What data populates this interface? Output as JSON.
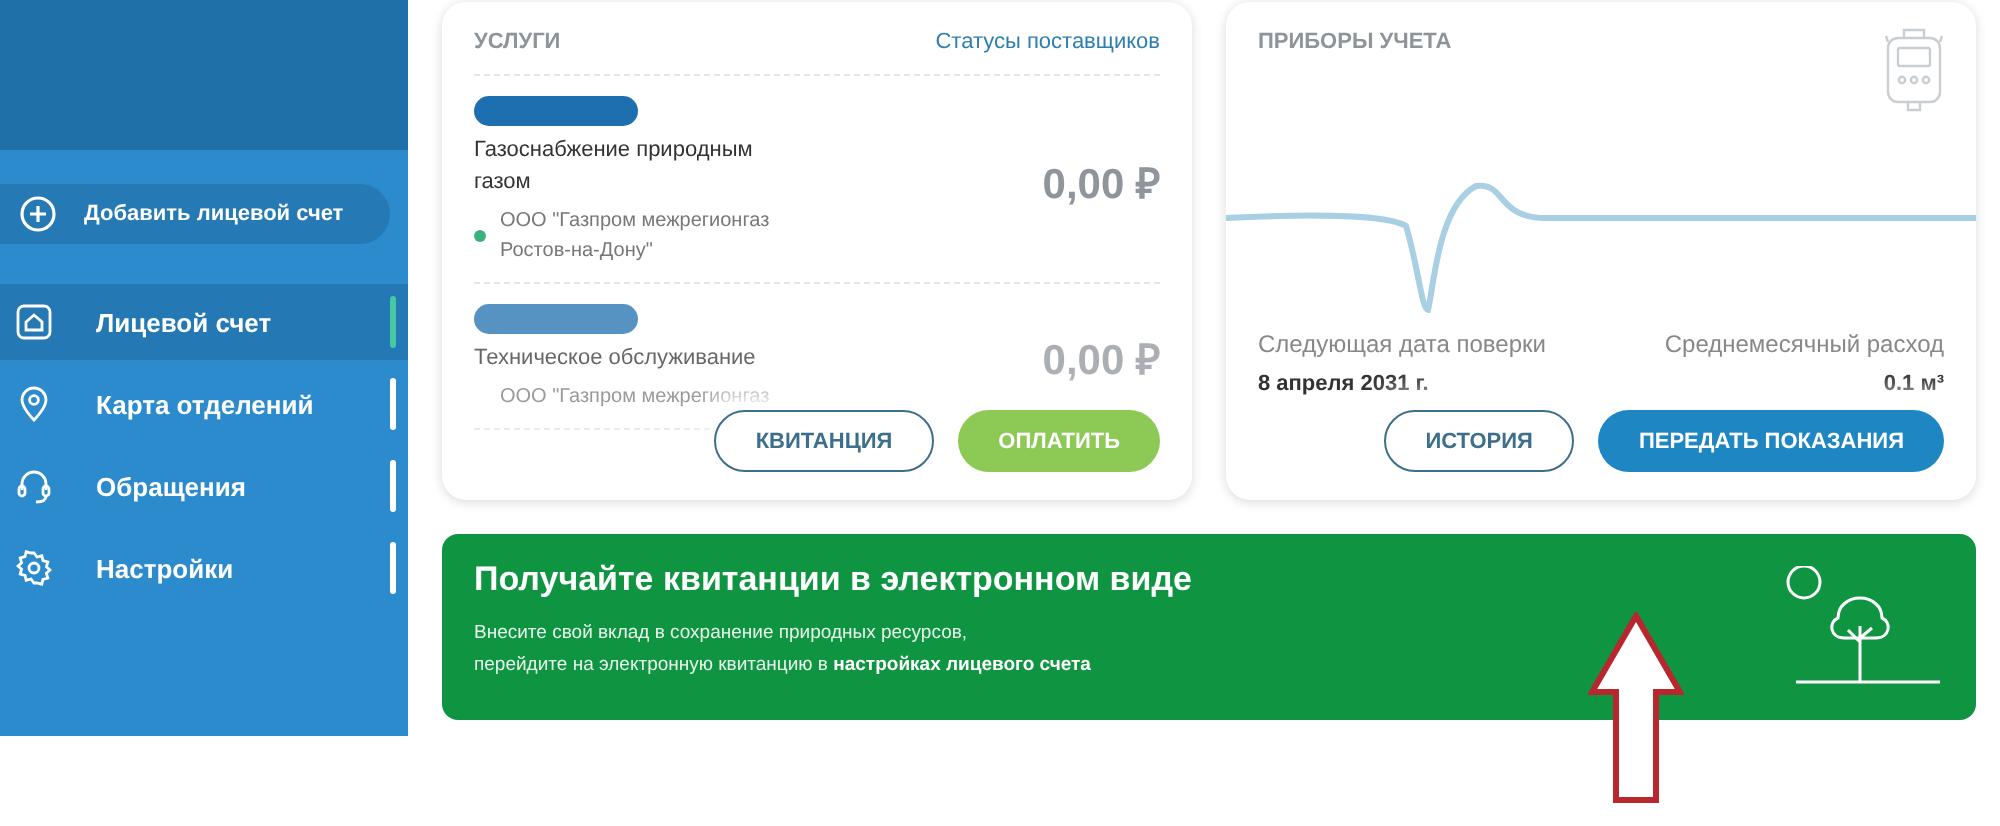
{
  "sidebar": {
    "add_button": "Добавить лицевой счет",
    "items": [
      {
        "label": "Лицевой счет",
        "selected": true
      },
      {
        "label": "Карта отделений",
        "selected": false
      },
      {
        "label": "Обращения",
        "selected": false
      },
      {
        "label": "Настройки",
        "selected": false
      }
    ]
  },
  "services": {
    "title": "УСЛУГИ",
    "link": "Статусы поставщиков",
    "items": [
      {
        "name": "Газоснабжение природным газом",
        "provider": "ООО \"Газпром межрегионгаз Ростов-на-Дону\"",
        "amount": "0,00",
        "currency": "₽",
        "color": "#3cb37f",
        "faded": false
      },
      {
        "name": "Техническое обслуживание",
        "provider": "ООО \"Газпром межрегионгаз",
        "amount": "0,00",
        "currency": "₽",
        "faded": true
      }
    ],
    "buttons": [
      {
        "label": "КВИТАНЦИЯ",
        "kind": "outline"
      },
      {
        "label": "ОПЛАТИТЬ",
        "kind": "green"
      }
    ]
  },
  "meters": {
    "title": "ПРИБОРЫ УЧЕТА",
    "next_check_label": "Следующая дата поверки",
    "next_check_value": "8 апреля 2031 г.",
    "average_label": "Среднемесячный расход",
    "average_value": "0.1 м³",
    "buttons": [
      {
        "label": "ИСТОРИЯ",
        "kind": "outline"
      },
      {
        "label": "ПЕРЕДАТЬ ПОКАЗАНИЯ",
        "kind": "blue"
      }
    ]
  },
  "banner": {
    "title": "Получайте квитанции в электронном виде",
    "lines": [
      "Внесите свой вклад в сохранение природных ресурсов,",
      "перейдите на электронную квитанцию в **настройках лицевого счета**"
    ]
  }
}
